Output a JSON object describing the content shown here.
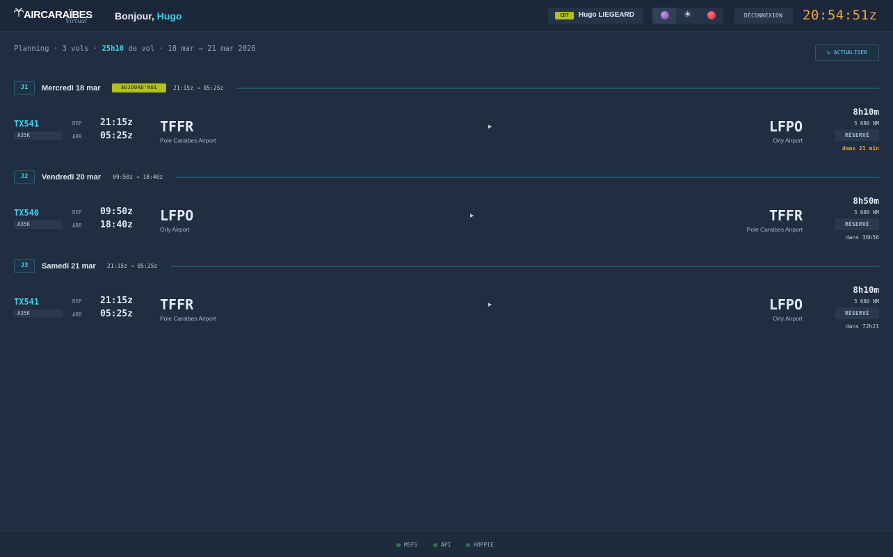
{
  "header": {
    "logo_text": "AIRCARAÏBES",
    "logo_sub": "Virtual",
    "greeting": "Bonjour,",
    "user_first_name": "Hugo",
    "rank": "CDT",
    "user_full_name": "Hugo LIEGEARD",
    "logout_label": "DÉCONNEXION",
    "clock": "20:54:51z"
  },
  "summary": {
    "prefix": "Planning · 3 vols ·",
    "total_time": "25h10",
    "suffix": "de vol · 18 mar → 21 mar 2026",
    "refresh_label": "↻ ACTUALISER"
  },
  "days": [
    {
      "badge": "J1",
      "title": "Mercredi 18 mar",
      "today_label": "AUJOURD'HUI",
      "range": "21:15z → 05:25z"
    },
    {
      "badge": "J2",
      "title": "Vendredi 20 mar",
      "range": "09:50z → 18:40z"
    },
    {
      "badge": "J3",
      "title": "Samedi 21 mar",
      "range": "21:15z → 05:25z"
    }
  ],
  "flights": [
    {
      "number": "TX541",
      "aircraft": "A35K",
      "dep_label": "DEP",
      "arr_label": "ARR",
      "dep_time": "21:15z",
      "arr_time": "05:25z",
      "from_icao": "TFFR",
      "from_name": "Pole Caraibes Airport",
      "to_icao": "LFPO",
      "to_name": "Orly Airport",
      "duration": "8h10m",
      "distance": "3 680 NM",
      "status": "RÉSERVÉ",
      "eta": "dans 21 min"
    },
    {
      "number": "TX540",
      "aircraft": "A35K",
      "dep_label": "DEP",
      "arr_label": "ARR",
      "dep_time": "09:50z",
      "arr_time": "18:40z",
      "from_icao": "LFPO",
      "from_name": "Orly Airport",
      "to_icao": "TFFR",
      "to_name": "Pole Caraibes Airport",
      "duration": "8h50m",
      "distance": "3 680 NM",
      "status": "RÉSERVÉ",
      "eta": "dans 36h56"
    },
    {
      "number": "TX541",
      "aircraft": "A35K",
      "dep_label": "DEP",
      "arr_label": "ARR",
      "dep_time": "21:15z",
      "arr_time": "05:25z",
      "from_icao": "TFFR",
      "from_name": "Pole Caraibes Airport",
      "to_icao": "LFPO",
      "to_name": "Orly Airport",
      "duration": "8h10m",
      "distance": "3 680 NM",
      "status": "RÉSERVÉ",
      "eta": "dans 72h21"
    }
  ],
  "footer": {
    "services": [
      "MSFS",
      "API",
      "HOPPIE"
    ]
  },
  "colors": {
    "background": "#212d40",
    "accent": "#3fd0ef",
    "clock": "#f0a73a",
    "today_badge": "#b4c11c",
    "status_ok": "#1f7a47"
  }
}
